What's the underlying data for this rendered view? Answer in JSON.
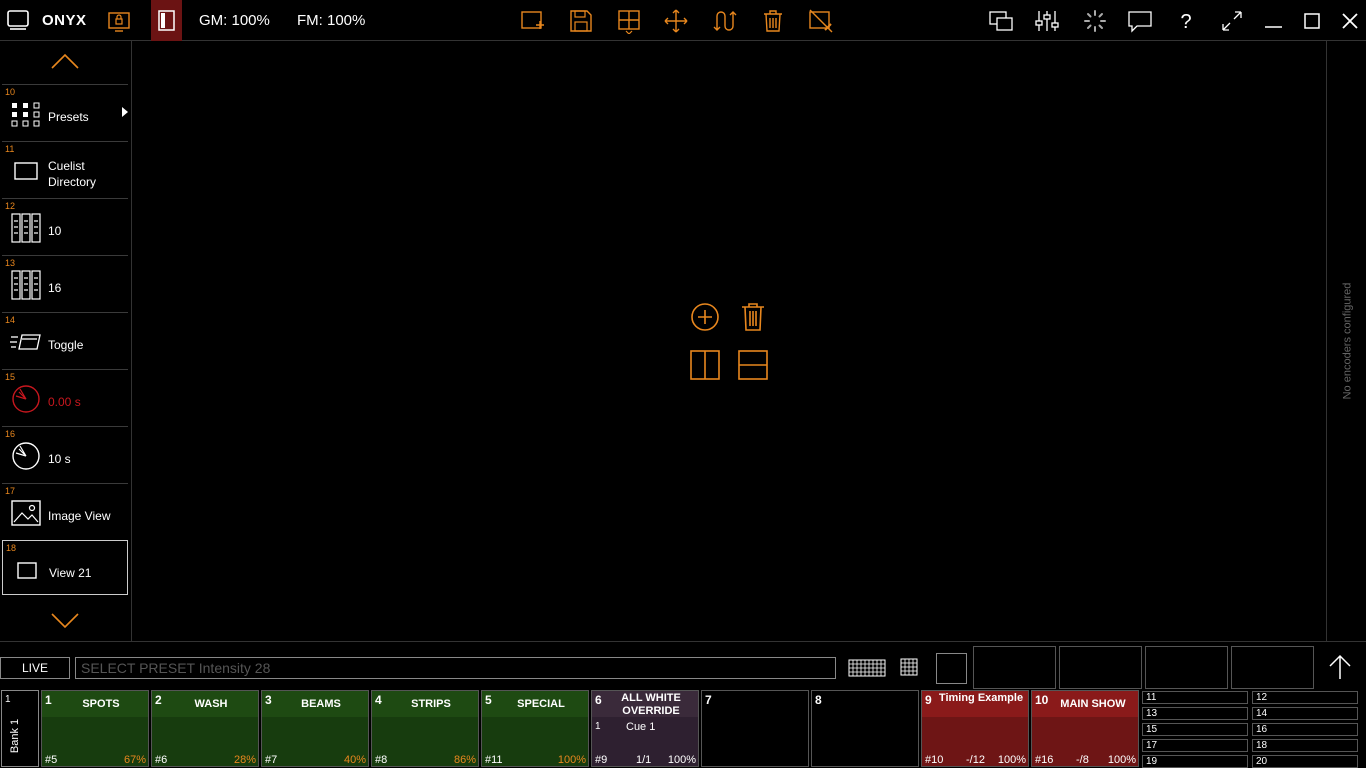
{
  "topbar": {
    "brand": "ONYX",
    "gm": "GM: 100%",
    "fm": "FM: 100%"
  },
  "colors": {
    "accent": "#e8871e",
    "selected": "#6b1313",
    "green": "#1e4a12",
    "red": "#8a1a1a"
  },
  "sidebar": {
    "items": [
      {
        "num": "10",
        "label": "Presets",
        "icon": "presets-grid-icon"
      },
      {
        "num": "11",
        "label": "Cuelist",
        "label2": "Directory",
        "icon": "cuelist-directory-icon"
      },
      {
        "num": "12",
        "label": "10",
        "icon": "faders-icon"
      },
      {
        "num": "13",
        "label": "16",
        "icon": "faders-icon"
      },
      {
        "num": "14",
        "label": "Toggle",
        "icon": "toggle-icon"
      },
      {
        "num": "15",
        "label": "0.00 s",
        "icon": "timer-red-icon"
      },
      {
        "num": "16",
        "label": "10 s",
        "icon": "timer-icon"
      },
      {
        "num": "17",
        "label": "Image View",
        "icon": "image-icon"
      },
      {
        "num": "18",
        "label": "View 21",
        "icon": "view-icon"
      }
    ]
  },
  "right_panel": {
    "text": "No encoders configured"
  },
  "command": {
    "mode": "LIVE",
    "line": "SELECT PRESET Intensity 28"
  },
  "bank": {
    "num": "1",
    "label": "Bank 1"
  },
  "playbacks": [
    {
      "num": "1",
      "name": "SPOTS",
      "foot_l": "#5",
      "foot_m": "",
      "foot_r": "67%"
    },
    {
      "num": "2",
      "name": "WASH",
      "foot_l": "#6",
      "foot_m": "",
      "foot_r": "28%"
    },
    {
      "num": "3",
      "name": "BEAMS",
      "foot_l": "#7",
      "foot_m": "",
      "foot_r": "40%"
    },
    {
      "num": "4",
      "name": "STRIPS",
      "foot_l": "#8",
      "foot_m": "",
      "foot_r": "86%"
    },
    {
      "num": "5",
      "name": "SPECIAL",
      "foot_l": "#11",
      "foot_m": "",
      "foot_r": "100%"
    },
    {
      "num": "6",
      "name": "ALL WHITE OVERRIDE",
      "cue_n": "1",
      "cue_name": "Cue 1",
      "foot_l": "#9",
      "foot_m": "1/1",
      "foot_r": "100%"
    },
    {
      "num": "7"
    },
    {
      "num": "8"
    },
    {
      "num": "9",
      "name": "Timing Example",
      "foot_l": "#10",
      "foot_m": "-/12",
      "foot_r": "100%"
    },
    {
      "num": "10",
      "name": "MAIN SHOW",
      "foot_l": "#16",
      "foot_m": "-/8",
      "foot_r": "100%"
    }
  ],
  "mini_playbacks": [
    "11",
    "12",
    "13",
    "14",
    "15",
    "16",
    "17",
    "18",
    "19",
    "20"
  ]
}
